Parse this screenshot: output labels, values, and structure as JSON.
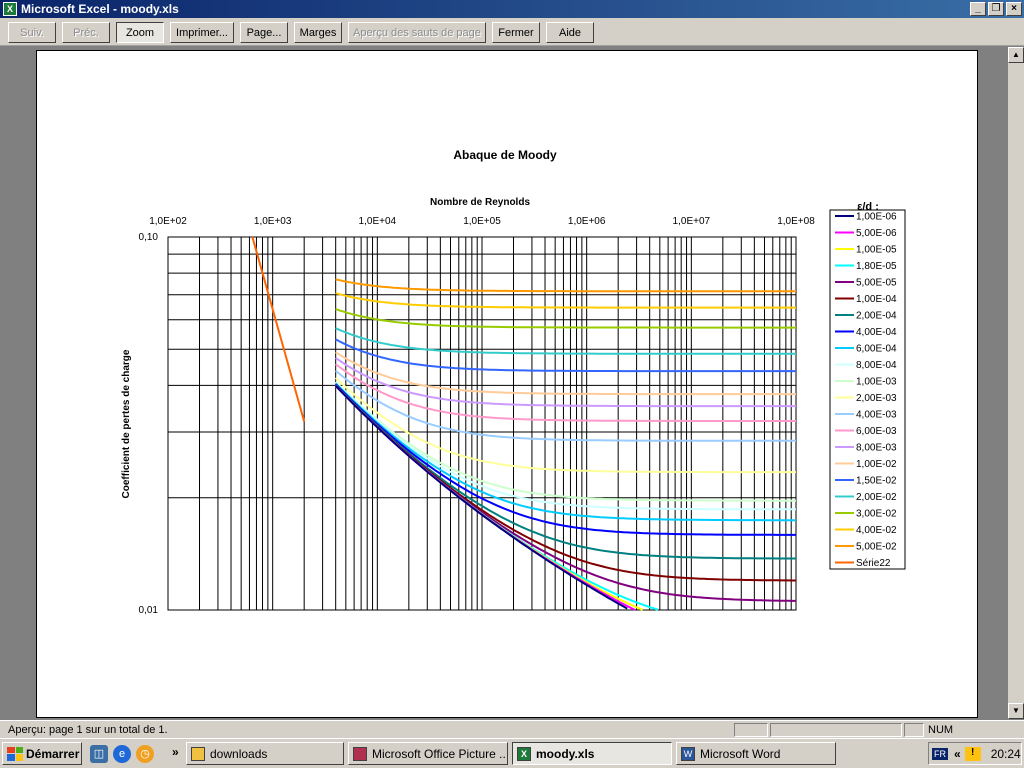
{
  "window": {
    "title": "Microsoft Excel - moody.xls",
    "app_icon": "excel-icon"
  },
  "toolbar": {
    "buttons": [
      {
        "label": "Suiv.",
        "enabled": false
      },
      {
        "label": "Préc.",
        "enabled": false
      },
      {
        "label": "Zoom",
        "enabled": true,
        "pressed": true
      },
      {
        "label": "Imprimer...",
        "enabled": true
      },
      {
        "label": "Page...",
        "enabled": true
      },
      {
        "label": "Marges",
        "enabled": true
      },
      {
        "label": "Aperçu des sauts de page",
        "enabled": false
      },
      {
        "label": "Fermer",
        "enabled": true
      },
      {
        "label": "Aide",
        "enabled": true
      }
    ]
  },
  "chart_data": {
    "type": "line",
    "title": "Abaque de Moody",
    "xlabel": "Nombre de Reynolds",
    "ylabel": "Coefficient de pertes de charge",
    "x_scale": "log",
    "y_scale": "log",
    "xlim": [
      100,
      100000000
    ],
    "ylim": [
      0.01,
      0.1
    ],
    "x_tick_labels": [
      "1,0E+02",
      "1,0E+03",
      "1,0E+04",
      "1,0E+05",
      "1,0E+06",
      "1,0E+07",
      "1,0E+08"
    ],
    "y_tick_labels": [
      "0,10",
      "0,01"
    ],
    "x_axis_position": "top",
    "grid": true,
    "legend_title": "ε/d :",
    "legend_position": "right",
    "series": [
      {
        "name": "1,00E-06",
        "eps_d": 1e-06,
        "color": "#000080"
      },
      {
        "name": "5,00E-06",
        "eps_d": 5e-06,
        "color": "#ff00ff"
      },
      {
        "name": "1,00E-05",
        "eps_d": 1e-05,
        "color": "#ffff00"
      },
      {
        "name": "1,80E-05",
        "eps_d": 1.8e-05,
        "color": "#00ffff"
      },
      {
        "name": "5,00E-05",
        "eps_d": 5e-05,
        "color": "#800080"
      },
      {
        "name": "1,00E-04",
        "eps_d": 0.0001,
        "color": "#800000"
      },
      {
        "name": "2,00E-04",
        "eps_d": 0.0002,
        "color": "#008080"
      },
      {
        "name": "4,00E-04",
        "eps_d": 0.0004,
        "color": "#0000ff"
      },
      {
        "name": "6,00E-04",
        "eps_d": 0.0006,
        "color": "#00ccff"
      },
      {
        "name": "8,00E-04",
        "eps_d": 0.0008,
        "color": "#ccffff"
      },
      {
        "name": "1,00E-03",
        "eps_d": 0.001,
        "color": "#ccffcc"
      },
      {
        "name": "2,00E-03",
        "eps_d": 0.002,
        "color": "#ffff99"
      },
      {
        "name": "4,00E-03",
        "eps_d": 0.004,
        "color": "#99ccff"
      },
      {
        "name": "6,00E-03",
        "eps_d": 0.006,
        "color": "#ff99cc"
      },
      {
        "name": "8,00E-03",
        "eps_d": 0.008,
        "color": "#cc99ff"
      },
      {
        "name": "1,00E-02",
        "eps_d": 0.01,
        "color": "#ffcc99"
      },
      {
        "name": "1,50E-02",
        "eps_d": 0.015,
        "color": "#3366ff"
      },
      {
        "name": "2,00E-02",
        "eps_d": 0.02,
        "color": "#33cccc"
      },
      {
        "name": "3,00E-02",
        "eps_d": 0.03,
        "color": "#99cc00"
      },
      {
        "name": "4,00E-02",
        "eps_d": 0.04,
        "color": "#ffcc00"
      },
      {
        "name": "5,00E-02",
        "eps_d": 0.05,
        "color": "#ff9900"
      }
    ],
    "laminar_series": {
      "name": "Série22",
      "color": "#ff6600",
      "x": [
        640,
        2000
      ],
      "y": [
        0.1,
        0.032
      ]
    }
  },
  "statusbar": {
    "text": "Aperçu: page 1 sur un total de 1.",
    "num": "NUM"
  },
  "taskbar": {
    "start": "Démarrer",
    "quicklaunch_icon": "»",
    "tasks": [
      {
        "label": "downloads",
        "icon": "folder-icon",
        "active": false
      },
      {
        "label": "Microsoft Office Picture ...",
        "icon": "picture-manager-icon",
        "active": false
      },
      {
        "label": "moody.xls",
        "icon": "excel-icon",
        "active": true
      },
      {
        "label": "Microsoft Word",
        "icon": "word-icon",
        "active": false
      }
    ],
    "tray": {
      "lang": "FR",
      "arrow": "«",
      "time": "20:24"
    }
  }
}
